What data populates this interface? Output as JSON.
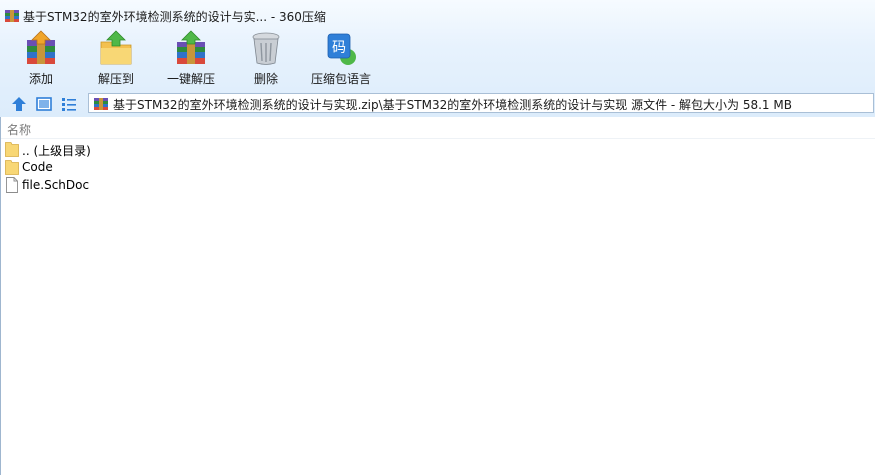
{
  "window": {
    "title": "基于STM32的室外环境检测系统的设计与实... - 360压缩"
  },
  "toolbar": {
    "add_label": "添加",
    "extract_label": "解压到",
    "one_click_label": "一键解压",
    "delete_label": "删除",
    "language_label": "压缩包语言",
    "language_icon_char": "码"
  },
  "address": {
    "path": "基于STM32的室外环境检测系统的设计与实现.zip\\基于STM32的室外环境检测系统的设计与实现 源文件 - 解包大小为 58.1 MB"
  },
  "list": {
    "column_name": "名称",
    "items": [
      {
        "name": ".. (上级目录)",
        "type": "folder"
      },
      {
        "name": "Code",
        "type": "folder"
      },
      {
        "name": "file.SchDoc",
        "type": "file"
      }
    ]
  },
  "colors": {
    "chrome_bg": "#e7f2fd",
    "address_border": "#a9bfd6",
    "folder": "#f8d775",
    "accent_blue": "#2f7fd8"
  }
}
